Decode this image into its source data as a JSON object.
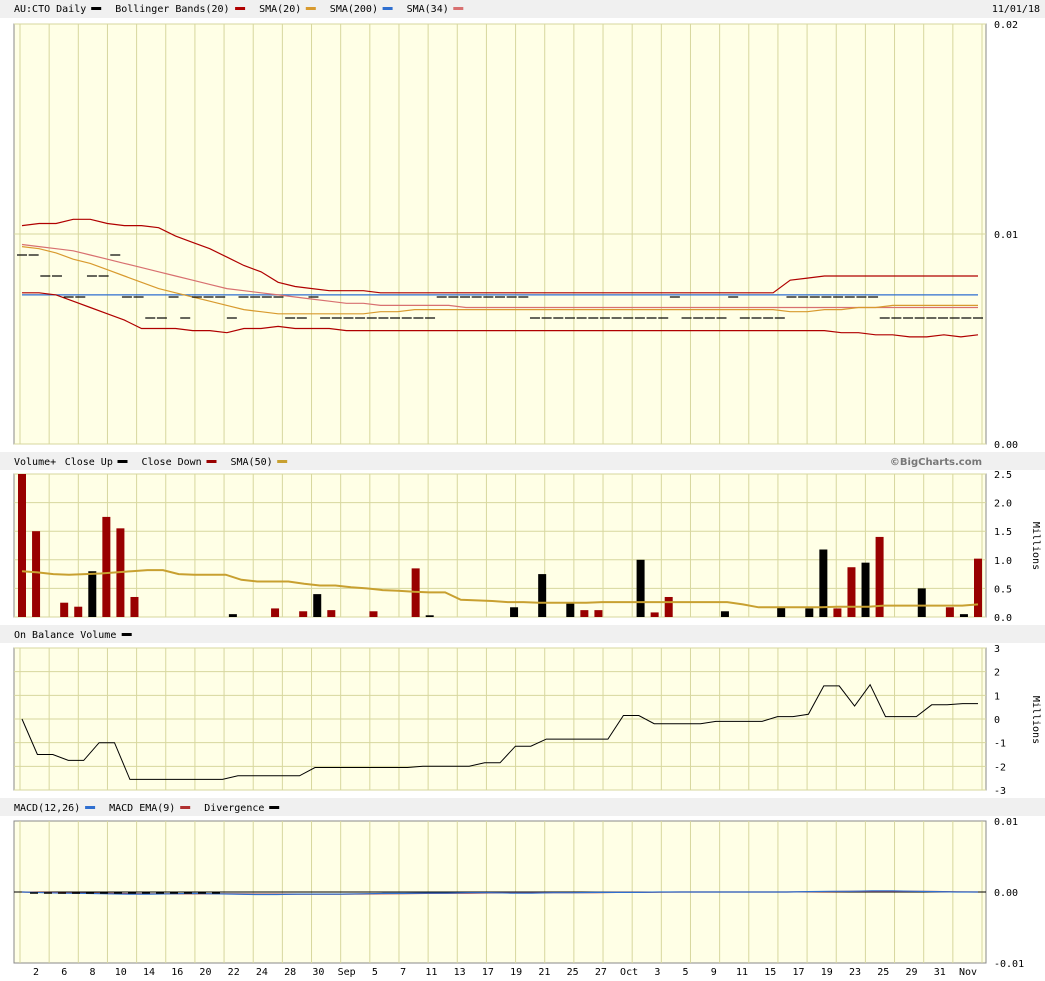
{
  "header": {
    "symbol": "AU:CTO Daily",
    "date": "11/01/18",
    "copyright": "©BigCharts.com"
  },
  "colors": {
    "plot_bg": "#ffffe6",
    "grid": "#d7d79e",
    "up": "#000000",
    "down": "#990000",
    "sma20": "#b00000",
    "sma200": "#d89a2e",
    "sma34_overlay": "#d87070",
    "bollinger": "#b00000",
    "sma_blue": "#2f6fd0",
    "vol_sma": "#c8a030",
    "macd": "#2f6fd0",
    "macd_ema": "#b03030"
  },
  "chart_data": [
    {
      "panel": "price",
      "type": "candlestick",
      "legend": [
        {
          "label": "AU:CTO Daily",
          "color": "#000000"
        },
        {
          "label": "Bollinger Bands(20)",
          "color": "#b00000"
        },
        {
          "label": "SMA(20)",
          "color": "#d89a2e"
        },
        {
          "label": "SMA(200)",
          "color": "#2f6fd0"
        },
        {
          "label": "SMA(34)",
          "color": "#d87070"
        }
      ],
      "y_ticks": [
        "0.02",
        "0.01",
        "0.00"
      ],
      "ylim": [
        0,
        0.02
      ],
      "close": [
        0.009,
        0.009,
        0.008,
        0.008,
        0.007,
        0.007,
        0.008,
        0.008,
        0.009,
        0.007,
        0.007,
        0.006,
        0.006,
        0.007,
        0.006,
        0.007,
        0.007,
        0.007,
        0.006,
        0.007,
        0.007,
        0.007,
        0.007,
        0.006,
        0.006,
        0.007,
        0.006,
        0.006,
        0.006,
        0.006,
        0.006,
        0.006,
        0.006,
        0.006,
        0.006,
        0.006,
        0.007,
        0.007,
        0.007,
        0.007,
        0.007,
        0.007,
        0.007,
        0.007,
        0.006,
        0.006,
        0.006,
        0.006,
        0.006,
        0.006,
        0.006,
        0.006,
        0.006,
        0.006,
        0.006,
        0.006,
        0.007,
        0.006,
        0.006,
        0.006,
        0.006,
        0.007,
        0.006,
        0.006,
        0.006,
        0.006,
        0.007,
        0.007,
        0.007,
        0.007,
        0.007,
        0.007,
        0.007,
        0.007,
        0.006,
        0.006,
        0.006,
        0.006,
        0.006,
        0.006,
        0.006,
        0.006,
        0.006
      ],
      "bollinger_upper": [
        0.0104,
        0.0105,
        0.0105,
        0.0107,
        0.0107,
        0.0105,
        0.0104,
        0.0104,
        0.0103,
        0.0099,
        0.0096,
        0.0093,
        0.0089,
        0.0085,
        0.0082,
        0.0077,
        0.0075,
        0.0074,
        0.0073,
        0.0073,
        0.0073,
        0.0072,
        0.0072,
        0.0072,
        0.0072,
        0.0072,
        0.0072,
        0.0072,
        0.0072,
        0.0072,
        0.0072,
        0.0072,
        0.0072,
        0.0072,
        0.0072,
        0.0072,
        0.0072,
        0.0072,
        0.0072,
        0.0072,
        0.0072,
        0.0072,
        0.0072,
        0.0072,
        0.0072,
        0.0078,
        0.0079,
        0.008,
        0.008,
        0.008,
        0.008,
        0.008,
        0.008,
        0.008,
        0.008,
        0.008,
        0.008
      ],
      "bollinger_lower": [
        0.0072,
        0.0072,
        0.0071,
        0.0068,
        0.0065,
        0.0062,
        0.0059,
        0.0055,
        0.0055,
        0.0055,
        0.0054,
        0.0054,
        0.0053,
        0.0055,
        0.0055,
        0.0056,
        0.0055,
        0.0055,
        0.0055,
        0.0054,
        0.0054,
        0.0054,
        0.0054,
        0.0054,
        0.0054,
        0.0054,
        0.0054,
        0.0054,
        0.0054,
        0.0054,
        0.0054,
        0.0054,
        0.0054,
        0.0054,
        0.0054,
        0.0054,
        0.0054,
        0.0054,
        0.0054,
        0.0054,
        0.0054,
        0.0054,
        0.0054,
        0.0054,
        0.0054,
        0.0054,
        0.0054,
        0.0054,
        0.0053,
        0.0053,
        0.0052,
        0.0052,
        0.0051,
        0.0051,
        0.0052,
        0.0051,
        0.0052
      ],
      "sma20": [
        0.0094,
        0.0093,
        0.0091,
        0.0088,
        0.0086,
        0.0083,
        0.008,
        0.0077,
        0.0074,
        0.0072,
        0.007,
        0.0068,
        0.0066,
        0.0064,
        0.0063,
        0.0062,
        0.0062,
        0.0062,
        0.0062,
        0.0062,
        0.0062,
        0.0063,
        0.0063,
        0.0064,
        0.0064,
        0.0064,
        0.0064,
        0.0064,
        0.0064,
        0.0064,
        0.0064,
        0.0064,
        0.0064,
        0.0064,
        0.0064,
        0.0064,
        0.0064,
        0.0064,
        0.0064,
        0.0064,
        0.0064,
        0.0064,
        0.0064,
        0.0064,
        0.0064,
        0.0063,
        0.0063,
        0.0064,
        0.0064,
        0.0065,
        0.0065,
        0.0066,
        0.0066,
        0.0066,
        0.0066,
        0.0066,
        0.0066
      ],
      "sma200": [
        0.0071,
        0.0071,
        0.0071,
        0.0071,
        0.0071,
        0.0071,
        0.0071,
        0.0071,
        0.0071,
        0.0071,
        0.0071,
        0.0071,
        0.0071,
        0.0071,
        0.0071,
        0.0071,
        0.0071,
        0.0071,
        0.0071,
        0.0071,
        0.0071,
        0.0071,
        0.0071,
        0.0071,
        0.0071,
        0.0071,
        0.0071,
        0.0071,
        0.0071,
        0.0071,
        0.0071,
        0.0071,
        0.0071,
        0.0071,
        0.0071,
        0.0071,
        0.0071,
        0.0071,
        0.0071,
        0.0071,
        0.0071,
        0.0071,
        0.0071,
        0.0071,
        0.0071,
        0.0071,
        0.0071,
        0.0071,
        0.0071,
        0.0071,
        0.0071,
        0.0071,
        0.0071,
        0.0071,
        0.0071,
        0.0071,
        0.0071
      ],
      "sma34": [
        0.0095,
        0.0094,
        0.0093,
        0.0092,
        0.009,
        0.0088,
        0.0086,
        0.0084,
        0.0082,
        0.008,
        0.0078,
        0.0076,
        0.0074,
        0.0073,
        0.0072,
        0.0071,
        0.007,
        0.0069,
        0.0068,
        0.0067,
        0.0067,
        0.0066,
        0.0066,
        0.0066,
        0.0066,
        0.0066,
        0.0065,
        0.0065,
        0.0065,
        0.0065,
        0.0065,
        0.0065,
        0.0065,
        0.0065,
        0.0065,
        0.0065,
        0.0065,
        0.0065,
        0.0065,
        0.0065,
        0.0065,
        0.0065,
        0.0065,
        0.0065,
        0.0065,
        0.0065,
        0.0065,
        0.0065,
        0.0065,
        0.0065,
        0.0065,
        0.0065,
        0.0065,
        0.0065,
        0.0065,
        0.0065,
        0.0065
      ]
    },
    {
      "panel": "volume",
      "type": "bar",
      "legend": [
        {
          "label": "Volume+",
          "color": ""
        },
        {
          "label": "Close Up",
          "color": "#000000"
        },
        {
          "label": "Close Down",
          "color": "#990000"
        },
        {
          "label": "SMA(50)",
          "color": "#c8a030"
        }
      ],
      "y_ticks": [
        "2.5",
        "2.0",
        "1.5",
        "1.0",
        "0.5",
        "0.0"
      ],
      "ylabel": "Millions",
      "ylim": [
        0,
        2.5
      ],
      "values": [
        2.5,
        1.5,
        0.0,
        0.25,
        0.18,
        0.8,
        1.75,
        1.55,
        0.35,
        0.0,
        0.0,
        0.0,
        0.0,
        0.0,
        0.0,
        0.05,
        0.0,
        0.0,
        0.15,
        0.0,
        0.1,
        0.4,
        0.12,
        0.0,
        0.0,
        0.1,
        0.0,
        0.0,
        0.85,
        0.03,
        0.0,
        0.0,
        0.0,
        0.0,
        0.0,
        0.17,
        0.0,
        0.75,
        0.0,
        0.25,
        0.12,
        0.12,
        0.0,
        0.0,
        1.0,
        0.08,
        0.35,
        0.0,
        0.0,
        0.0,
        0.1,
        0.0,
        0.0,
        0.0,
        0.18,
        0.0,
        0.15,
        1.18,
        0.15,
        0.87,
        0.95,
        1.4,
        0.0,
        0.0,
        0.5,
        0.0,
        0.17,
        0.05,
        1.02
      ],
      "up": [
        false,
        false,
        false,
        false,
        false,
        true,
        false,
        false,
        false,
        false,
        false,
        false,
        false,
        false,
        false,
        true,
        false,
        false,
        false,
        false,
        false,
        true,
        false,
        false,
        false,
        false,
        false,
        false,
        false,
        true,
        false,
        false,
        false,
        false,
        false,
        true,
        false,
        true,
        false,
        true,
        false,
        false,
        false,
        false,
        true,
        false,
        false,
        false,
        false,
        false,
        true,
        false,
        false,
        false,
        true,
        false,
        true,
        true,
        false,
        false,
        true,
        false,
        false,
        false,
        true,
        false,
        false,
        true,
        false
      ],
      "sma50": [
        0.8,
        0.78,
        0.75,
        0.74,
        0.75,
        0.76,
        0.78,
        0.8,
        0.82,
        0.82,
        0.75,
        0.74,
        0.74,
        0.74,
        0.65,
        0.62,
        0.62,
        0.62,
        0.58,
        0.55,
        0.55,
        0.52,
        0.5,
        0.47,
        0.46,
        0.44,
        0.43,
        0.43,
        0.3,
        0.29,
        0.28,
        0.26,
        0.26,
        0.25,
        0.25,
        0.25,
        0.25,
        0.26,
        0.26,
        0.26,
        0.26,
        0.26,
        0.26,
        0.26,
        0.26,
        0.26,
        0.22,
        0.17,
        0.17,
        0.17,
        0.17,
        0.17,
        0.18,
        0.18,
        0.18,
        0.2,
        0.2,
        0.2,
        0.2,
        0.2,
        0.2,
        0.22
      ]
    },
    {
      "panel": "obv",
      "type": "line",
      "legend": [
        {
          "label": "On Balance Volume",
          "color": "#000000"
        }
      ],
      "y_ticks": [
        "3",
        "2",
        "1",
        "0",
        "-1",
        "-2",
        "-3"
      ],
      "ylabel": "Millions",
      "ylim": [
        -3,
        3
      ],
      "values": [
        0.0,
        -1.5,
        -1.5,
        -1.75,
        -1.75,
        -1.0,
        -1.0,
        -2.55,
        -2.55,
        -2.55,
        -2.55,
        -2.55,
        -2.55,
        -2.55,
        -2.4,
        -2.4,
        -2.4,
        -2.4,
        -2.4,
        -2.05,
        -2.05,
        -2.05,
        -2.05,
        -2.05,
        -2.05,
        -2.05,
        -2.0,
        -2.0,
        -2.0,
        -2.0,
        -1.85,
        -1.85,
        -1.15,
        -1.15,
        -0.85,
        -0.85,
        -0.85,
        -0.85,
        -0.85,
        0.15,
        0.15,
        -0.2,
        -0.2,
        -0.2,
        -0.2,
        -0.1,
        -0.1,
        -0.1,
        -0.1,
        0.1,
        0.1,
        0.2,
        1.4,
        1.4,
        0.55,
        1.45,
        0.1,
        0.1,
        0.1,
        0.6,
        0.6,
        0.65,
        0.65
      ]
    },
    {
      "panel": "macd",
      "type": "line",
      "legend": [
        {
          "label": "MACD(12,26)",
          "color": "#2f6fd0"
        },
        {
          "label": "MACD EMA(9)",
          "color": "#b03030"
        },
        {
          "label": "Divergence",
          "color": "#000000"
        }
      ],
      "y_ticks": [
        "0.01",
        "0.00",
        "-0.01"
      ],
      "ylim": [
        -0.01,
        0.01
      ],
      "macd": [
        0.0,
        -0.0001,
        -0.00015,
        -0.0002,
        -0.00025,
        -0.0003,
        -0.0003,
        -0.00025,
        -0.0002,
        -0.00025,
        -0.0003,
        -0.00035,
        -0.00035,
        -0.0003,
        -0.0003,
        -0.0003,
        -0.00025,
        -0.0002,
        -0.0002,
        -0.00015,
        -0.00015,
        -0.0001,
        -0.0001,
        -0.00015,
        -0.00015,
        -0.0001,
        -0.0001,
        -5e-05,
        -5e-05,
        -5e-05,
        0.0,
        0.0,
        0.0,
        0.0,
        0.0,
        0.0,
        0.0,
        5e-05,
        0.0001,
        0.0001,
        0.00015,
        0.00015,
        0.0001,
        5e-05,
        0.0,
        0.0
      ],
      "signal": [
        0.0,
        -5e-05,
        -0.0001,
        -0.00015,
        -0.0002,
        -0.00022,
        -0.00025,
        -0.00025,
        -0.00025,
        -0.00025,
        -0.00027,
        -0.0003,
        -0.0003,
        -0.0003,
        -0.0003,
        -0.0003,
        -0.00028,
        -0.00025,
        -0.00022,
        -0.0002,
        -0.00018,
        -0.00015,
        -0.00013,
        -0.00013,
        -0.00013,
        -0.0001,
        -0.0001,
        -8e-05,
        -5e-05,
        -5e-05,
        -3e-05,
        0.0,
        0.0,
        0.0,
        0.0,
        0.0,
        0.0,
        3e-05,
        5e-05,
        8e-05,
        0.0001,
        0.0001,
        0.0001,
        7e-05,
        3e-05,
        0.0
      ],
      "divergence": [
        0.0,
        -5e-05,
        -5e-05,
        -5e-05,
        -5e-05,
        -8e-05,
        -5e-05,
        0.0,
        5e-05,
        0.0,
        -3e-05,
        -5e-05,
        -5e-05,
        0.0
      ]
    }
  ],
  "x_axis": {
    "tick_labels": [
      "2",
      "6",
      "8",
      "10",
      "14",
      "16",
      "20",
      "22",
      "24",
      "28",
      "30",
      "Sep",
      "5",
      "7",
      "11",
      "13",
      "17",
      "19",
      "21",
      "25",
      "27",
      "Oct",
      "3",
      "5",
      "9",
      "11",
      "15",
      "17",
      "19",
      "23",
      "25",
      "29",
      "31",
      "Nov"
    ]
  }
}
